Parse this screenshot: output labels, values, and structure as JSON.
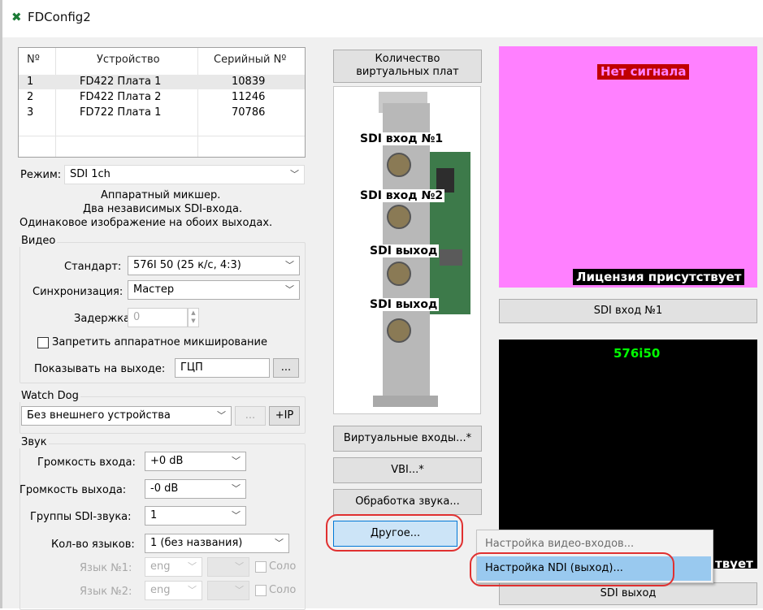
{
  "window": {
    "title": "FDConfig2"
  },
  "device_table": {
    "headers": [
      "Nº",
      "Устройство",
      "Серийный Nº"
    ],
    "rows": [
      {
        "num": "1",
        "device": "FD422 Плата 1",
        "serial": "10839"
      },
      {
        "num": "2",
        "device": "FD422 Плата 2",
        "serial": "11246"
      },
      {
        "num": "3",
        "device": "FD722 Плата 1",
        "serial": "70786"
      }
    ]
  },
  "mode": {
    "label": "Режим:",
    "value": "SDI 1ch",
    "description": [
      "Аппаратный микшер.",
      "Два независимых SDI-входа.",
      "Одинаковое изображение на обоих выходах."
    ]
  },
  "video": {
    "group_label": "Видео",
    "standard_label": "Стандарт:",
    "standard_value": "576I 50 (25 к/с, 4:3)",
    "sync_label": "Синхронизация:",
    "sync_value": "Мастер",
    "delay_label": "Задержка:",
    "delay_value": "0",
    "disable_mix_label": "Запретить аппаратное микширование",
    "show_output_label": "Показывать на выходе:",
    "show_output_value": "ГЦП",
    "browse_label": "..."
  },
  "watchdog": {
    "group_label": "Watch Dog",
    "value": "Без внешнего устройства",
    "dots_label": "...",
    "ip_label": "+IP"
  },
  "sound": {
    "group_label": "Звук",
    "input_volume_label": "Громкость входа:",
    "input_volume_value": "+0 dB",
    "output_volume_label": "Громкость выхода:",
    "output_volume_value": "-0 dB",
    "groups_label": "Группы SDI-звука:",
    "groups_value": "1",
    "languages_label": "Кол-во языков:",
    "languages_value": "1 (без названия)",
    "lang1_label": "Язык №1:",
    "lang1_value": "eng",
    "lang2_label": "Язык №2:",
    "lang2_value": "eng",
    "solo_label": "Соло"
  },
  "middle": {
    "virtual_boards_button": [
      "Количество",
      "виртуальных плат"
    ],
    "card_labels": [
      "SDI вход №1",
      "SDI вход №2",
      "SDI выход",
      "SDI выход"
    ],
    "virtual_inputs_button": "Виртуальные входы...*",
    "vbi_button": "VBI...*",
    "audio_processing_button": "Обработка звука...",
    "other_button": "Другое..."
  },
  "preview": {
    "no_signal": "Нет сигнала",
    "license": "Лицензия присутствует",
    "sdi_in1_button": "SDI вход №1",
    "format": "576i50",
    "license_partial": "твует",
    "sdi_out_button": "SDI выход"
  },
  "context_menu": {
    "items": [
      "Настройка видео-входов...",
      "Настройка NDI (выход)..."
    ]
  },
  "colors": {
    "preview_pink": "#ff80ff",
    "highlight_circle": "#e03030",
    "menu_highlight": "#99c9ef",
    "format_green": "#00ff00"
  }
}
